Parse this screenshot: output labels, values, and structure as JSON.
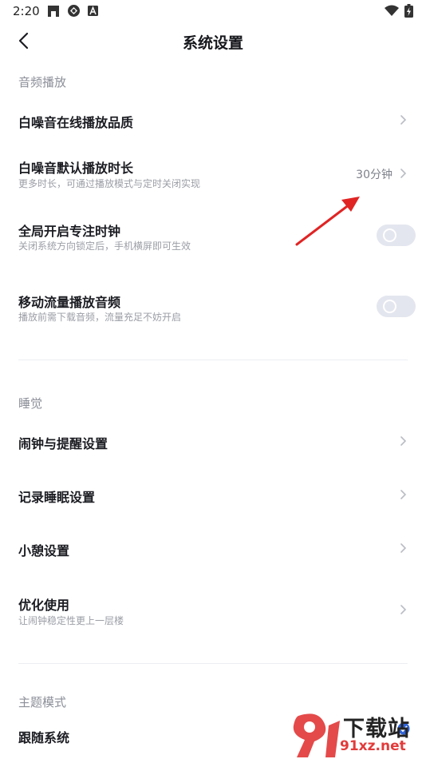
{
  "status_bar": {
    "time": "2:20"
  },
  "header": {
    "title": "系统设置"
  },
  "sections": {
    "audio": {
      "title": "音频播放",
      "quality": {
        "title": "白噪音在线播放品质"
      },
      "duration": {
        "title": "白噪音默认播放时长",
        "subtitle": "更多时长，可通过播放模式与定时关闭实现",
        "value": "30分钟"
      },
      "focus_clock": {
        "title": "全局开启专注时钟",
        "subtitle": "关闭系统方向锁定后，手机横屏即可生效",
        "enabled": false
      },
      "mobile_data": {
        "title": "移动流量播放音频",
        "subtitle": "播放前需下载音频，流量充足不妨开启",
        "enabled": false
      }
    },
    "sleep": {
      "title": "睡觉",
      "alarm": {
        "title": "闹钟与提醒设置"
      },
      "record": {
        "title": "记录睡眠设置"
      },
      "nap": {
        "title": "小憩设置"
      },
      "optimize": {
        "title": "优化使用",
        "subtitle": "让闹钟稳定性更上一层楼"
      }
    },
    "theme": {
      "title": "主题模式",
      "follow_system": {
        "title": "跟随系统"
      }
    }
  },
  "watermark": {
    "text": "下载站",
    "url": "91xz.net"
  },
  "colors": {
    "annotation_arrow": "#e02424",
    "toggle_off": "#e4e6ef",
    "section_header": "#8c8f99"
  }
}
